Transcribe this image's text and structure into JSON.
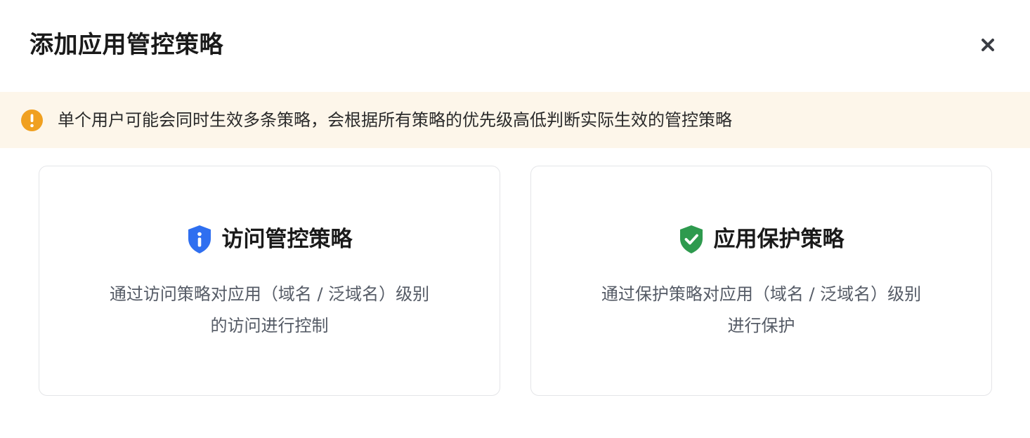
{
  "dialog": {
    "title": "添加应用管控策略",
    "close_icon": "close-icon"
  },
  "notice": {
    "icon": "warning-icon",
    "text": "单个用户可能会同时生效多条策略，会根据所有策略的优先级高低判断实际生效的管控策略",
    "background_color": "#fdf6ea",
    "icon_color": "#f0a020"
  },
  "cards": [
    {
      "icon": "info-shield-icon",
      "icon_color": "#2f6ff0",
      "title": "访问管控策略",
      "description_lines": [
        "通过访问策略对应用（域名 / 泛域名）级别",
        "的访问进行控制"
      ]
    },
    {
      "icon": "check-shield-icon",
      "icon_color": "#2e9a4e",
      "title": "应用保护策略",
      "description_lines": [
        "通过保护策略对应用（域名 / 泛域名）级别",
        "进行保护"
      ]
    }
  ]
}
